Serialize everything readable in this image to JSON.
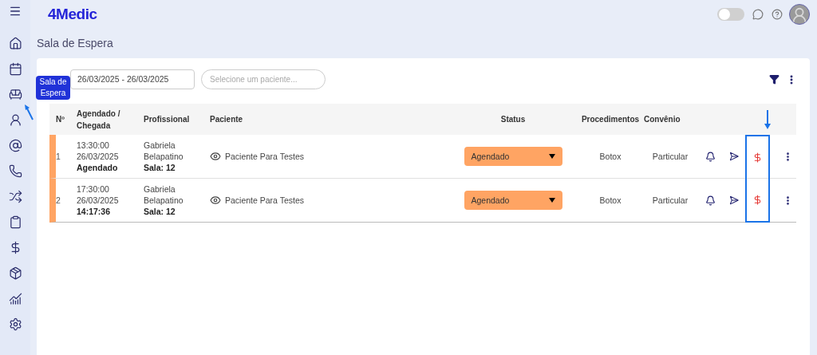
{
  "header": {
    "logo": "4Medic",
    "toggle": {
      "on": false
    }
  },
  "sidebar": {
    "tooltip": "Sala de Espera"
  },
  "page_title": "Sala de Espera",
  "filters": {
    "date_range": "26/03/2025 - 26/03/2025",
    "patient_search": {
      "placeholder": "Selecione um paciente..."
    }
  },
  "table": {
    "columns": [
      "Nº",
      "Agendado / Chegada",
      "Profissional",
      "Paciente",
      "Status",
      "Procedimentos",
      "Convênio"
    ],
    "rows": [
      {
        "number": "1",
        "time": "13:30:00",
        "date": "26/03/2025",
        "arrival": "Agendado",
        "professional": "Gabriela Belapatino",
        "room": "Sala: 12",
        "patient": "Paciente Para Testes",
        "status": "Agendado",
        "procedure": "Botox",
        "insurance": "Particular",
        "color": "#ffa463"
      },
      {
        "number": "2",
        "time": "17:30:00",
        "date": "26/03/2025",
        "arrival": "14:17:36",
        "professional": "Gabriela Belapatino",
        "room": "Sala: 12",
        "patient": "Paciente Para Testes",
        "status": "Agendado",
        "procedure": "Botox",
        "insurance": "Particular",
        "color": "#ffa463"
      }
    ]
  }
}
